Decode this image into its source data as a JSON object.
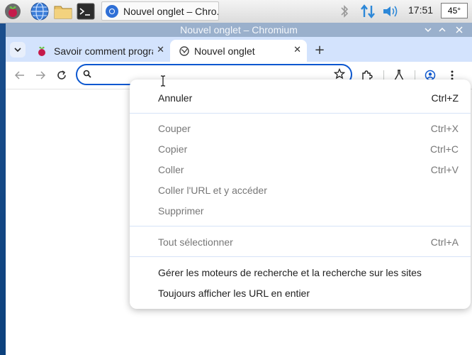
{
  "taskbar": {
    "task_label": "Nouvel onglet – Chro..",
    "clock": "17:51",
    "temperature": "45°",
    "icons": [
      "raspberry-menu-icon",
      "web-browser-icon",
      "file-manager-icon",
      "terminal-icon",
      "bluetooth-icon",
      "network-icon",
      "volume-icon"
    ]
  },
  "window": {
    "title": "Nouvel onglet – Chromium"
  },
  "tabs": [
    {
      "title": "Savoir comment progra",
      "active": false
    },
    {
      "title": "Nouvel onglet",
      "active": true
    }
  ],
  "omnibox": {
    "value": ""
  },
  "context_menu": {
    "groups": [
      [
        {
          "label": "Annuler",
          "shortcut": "Ctrl+Z",
          "enabled": true
        }
      ],
      [
        {
          "label": "Couper",
          "shortcut": "Ctrl+X",
          "enabled": false
        },
        {
          "label": "Copier",
          "shortcut": "Ctrl+C",
          "enabled": false
        },
        {
          "label": "Coller",
          "shortcut": "Ctrl+V",
          "enabled": false
        },
        {
          "label": "Coller l'URL et y accéder",
          "shortcut": "",
          "enabled": false
        },
        {
          "label": "Supprimer",
          "shortcut": "",
          "enabled": false
        }
      ],
      [
        {
          "label": "Tout sélectionner",
          "shortcut": "Ctrl+A",
          "enabled": false
        }
      ],
      [
        {
          "label": "Gérer les moteurs de recherche et la recherche sur les sites",
          "shortcut": "",
          "enabled": true
        },
        {
          "label": "Toujours afficher les URL en entier",
          "shortcut": "",
          "enabled": true
        }
      ]
    ]
  },
  "colors": {
    "accent": "#0b57d0",
    "tabstrip": "#d3e3fd",
    "titlebar": "#9ab0cc"
  }
}
